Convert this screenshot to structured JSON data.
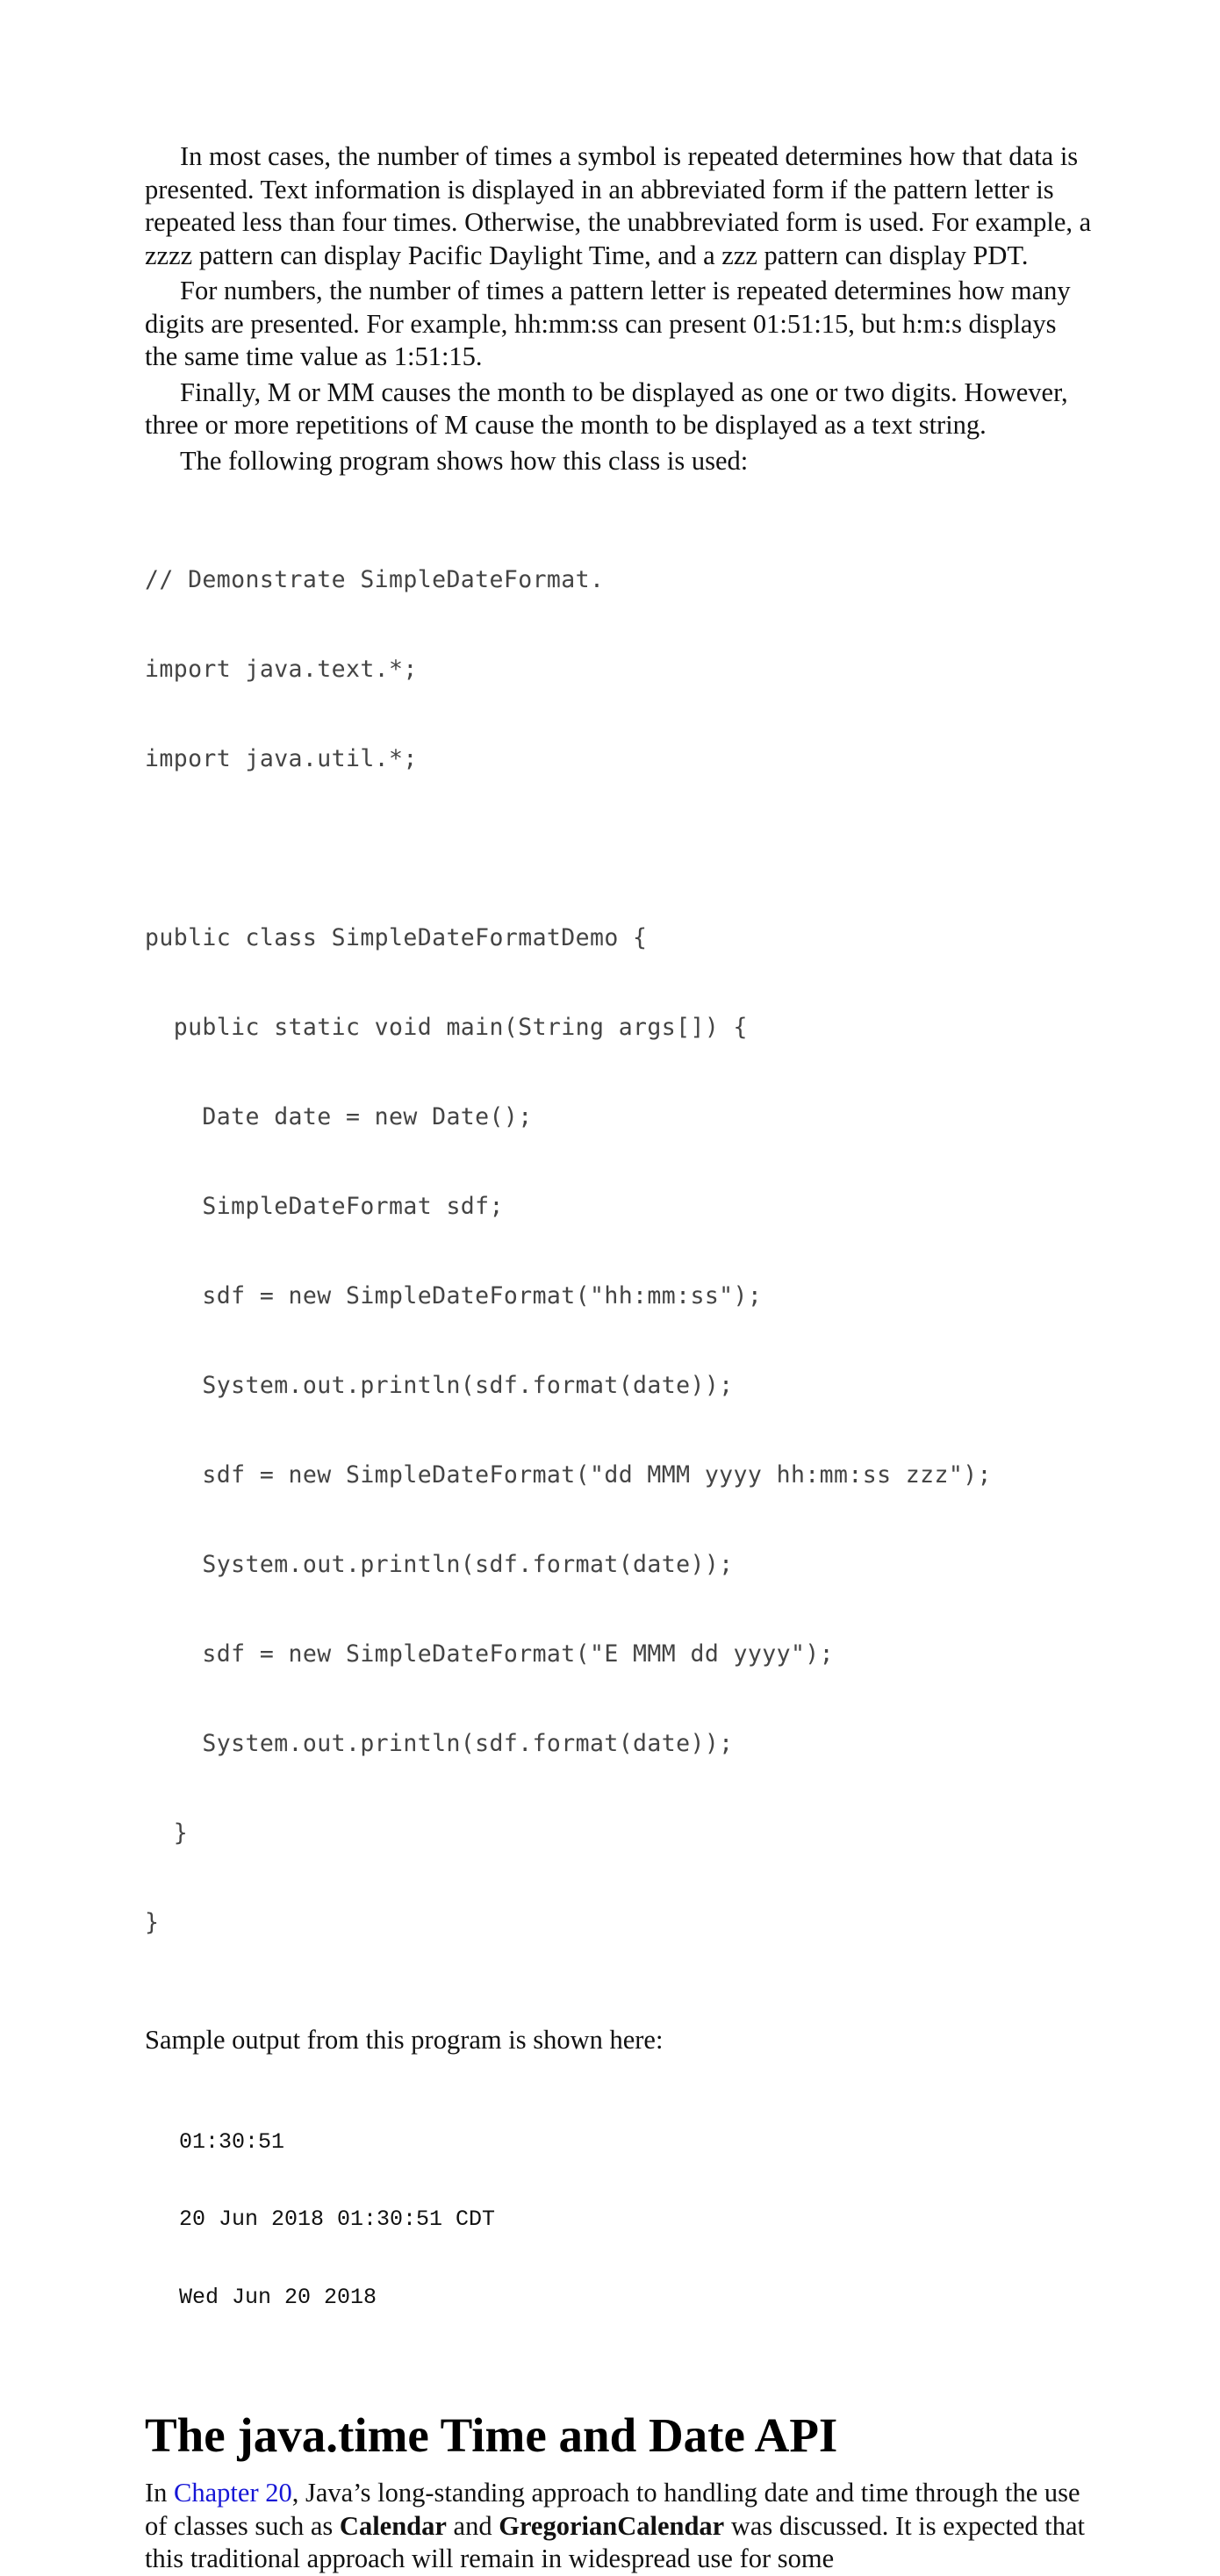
{
  "paragraphs": [
    "In most cases, the number of times a symbol is repeated determines how that data is presented. Text information is displayed in an abbreviated form if the pattern letter is repeated less than four times. Otherwise, the unabbreviated form is used. For example, a zzzz pattern can display Pacific Daylight Time, and a zzz pattern can display PDT.",
    "For numbers, the number of times a pattern letter is repeated determines how many digits are presented. For example, hh:mm:ss can present 01:51:15, but h:m:s displays the same time value as 1:51:15.",
    "Finally, M or MM causes the month to be displayed as one or two digits. However, three or more repetitions of M cause the month to be displayed as a text string.",
    "The following program shows how this class is used:"
  ],
  "code_lines": [
    "// Demonstrate SimpleDateFormat.",
    "import java.text.*;",
    "import java.util.*;",
    "",
    "public class SimpleDateFormatDemo {",
    "  public static void main(String args[]) {",
    "    Date date = new Date();",
    "    SimpleDateFormat sdf;",
    "    sdf = new SimpleDateFormat(\"hh:mm:ss\");",
    "    System.out.println(sdf.format(date));",
    "    sdf = new SimpleDateFormat(\"dd MMM yyyy hh:mm:ss zzz\");",
    "    System.out.println(sdf.format(date));",
    "    sdf = new SimpleDateFormat(\"E MMM dd yyyy\");",
    "    System.out.println(sdf.format(date));",
    "  }",
    "}"
  ],
  "sample_intro": "Sample output from this program is shown here:",
  "output_lines": [
    "01:30:51",
    "20 Jun 2018 01:30:51 CDT",
    "Wed Jun 20 2018"
  ],
  "section": {
    "heading": "The java.time Time and Date API",
    "intro_prefix": "In ",
    "chapter_link": "Chapter 20",
    "intro_mid1": ", Java’s long-standing approach to handling date and time through the use of classes such as ",
    "class1": "Calendar",
    "intro_mid2": " and ",
    "class2": "GregorianCalendar",
    "intro_suffix": " was discussed. It is expected that this traditional approach will remain in widespread use for some"
  },
  "colors": {
    "link": "#1515d6",
    "code_text": "#444444"
  }
}
